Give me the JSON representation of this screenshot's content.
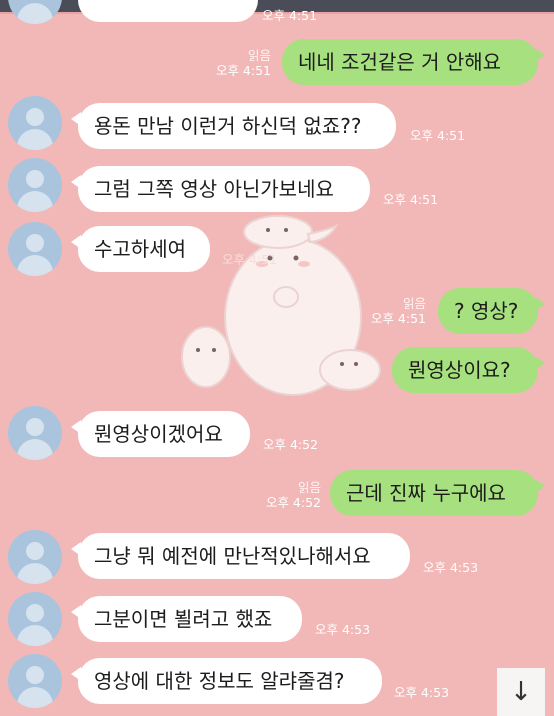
{
  "header": {
    "partial_time": "오후 4:51"
  },
  "messages": [
    {
      "side": "out",
      "text": "네네 조건같은 거 안해요",
      "read": "읽음",
      "time": "오후 4:51"
    },
    {
      "side": "in",
      "text": "용돈 만남 이런거 하신덕 없죠??",
      "time": "오후 4:51"
    },
    {
      "side": "in",
      "text": "그럼 그쪽 영상 아닌가보네요",
      "time": "오후 4:51"
    },
    {
      "side": "in",
      "text": "수고하세여",
      "time": "오후 4:51"
    },
    {
      "side": "out",
      "text": "? 영상?",
      "read": "읽음",
      "time": "오후 4:51"
    },
    {
      "side": "out",
      "text": "뭔영상이요?",
      "read": "",
      "time": ""
    },
    {
      "side": "in",
      "text": "뭔영상이겠어요",
      "time": "오후 4:52"
    },
    {
      "side": "out",
      "text": "근데 진짜 누구에요",
      "read": "읽음",
      "time": "오후 4:52"
    },
    {
      "side": "in",
      "text": "그냥 뭐 예전에 만난적있나해서요",
      "time": "오후 4:53"
    },
    {
      "side": "in",
      "text": "그분이면 뵐려고 했죠",
      "time": "오후 4:53"
    },
    {
      "side": "in",
      "text": "영상에 대한 정보도 알랴줄겸?",
      "time": "오후 4:53"
    }
  ],
  "scroll_button": {
    "icon": "arrow-down-icon",
    "glyph": "↓"
  },
  "colors": {
    "background": "#f2b8b8",
    "incoming": "#ffffff",
    "outgoing": "#a7e07f",
    "avatar": "#a9c4dc"
  }
}
